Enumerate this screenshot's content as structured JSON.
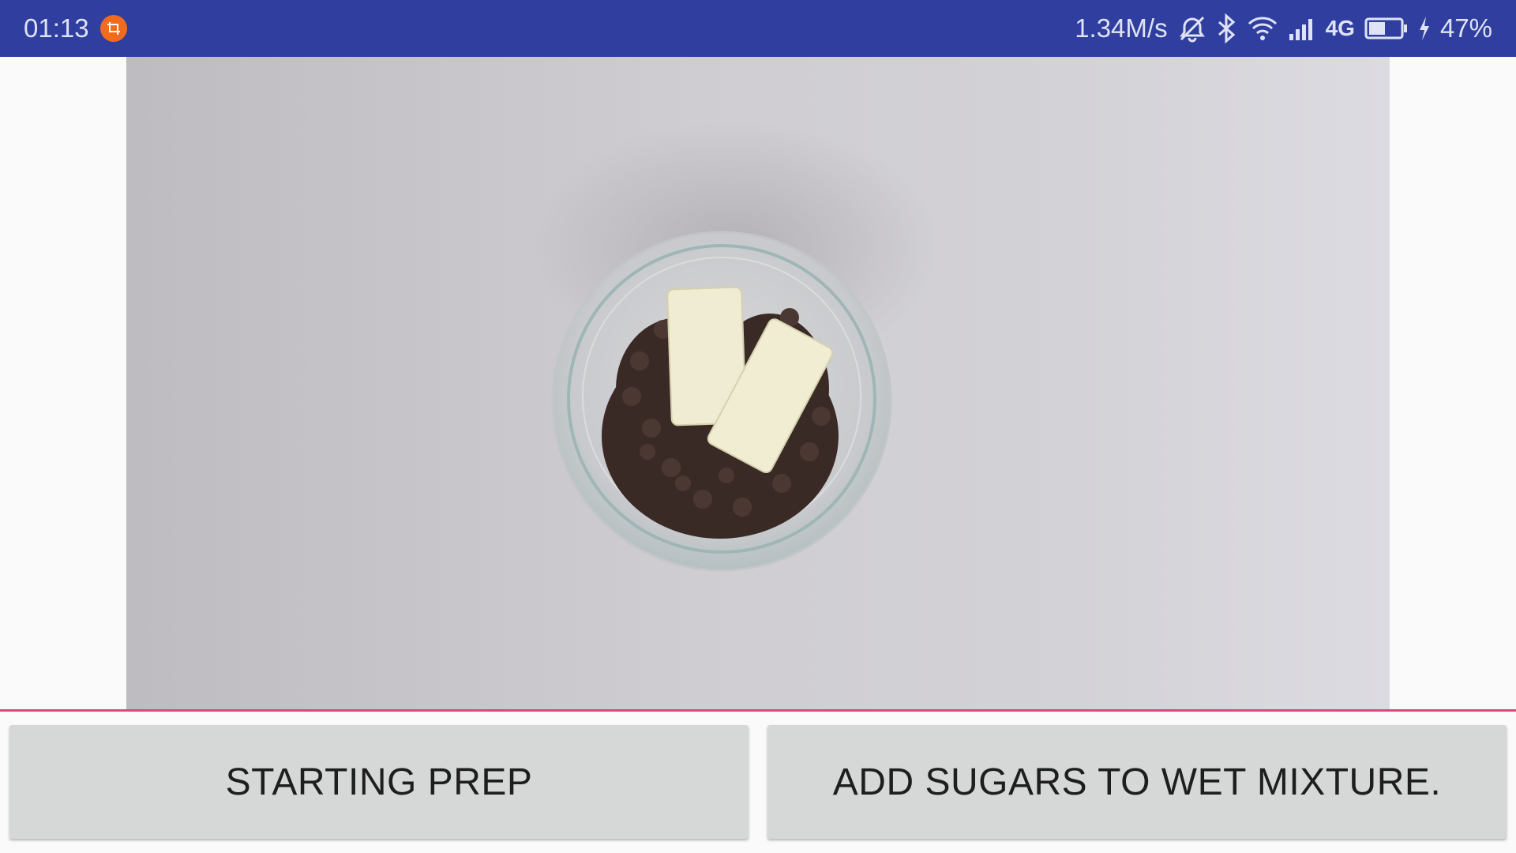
{
  "status_bar": {
    "time": "01:13",
    "net_speed": "1.34M/s",
    "network_type": "4G",
    "battery_percent": "47%",
    "bg_color": "#303f9f",
    "icons": [
      "screen-record-icon",
      "alarm-off-icon",
      "bluetooth-icon",
      "wifi-icon",
      "signal-icon",
      "battery-icon",
      "charging-icon"
    ]
  },
  "media": {
    "description_icon": "recipe-step-video"
  },
  "navigation": {
    "previous_label": "STARTING PREP",
    "next_label": "ADD SUGARS TO WET MIXTURE."
  },
  "colors": {
    "accent_divider": "#e0457b",
    "button_bg": "#d6d7d7"
  }
}
